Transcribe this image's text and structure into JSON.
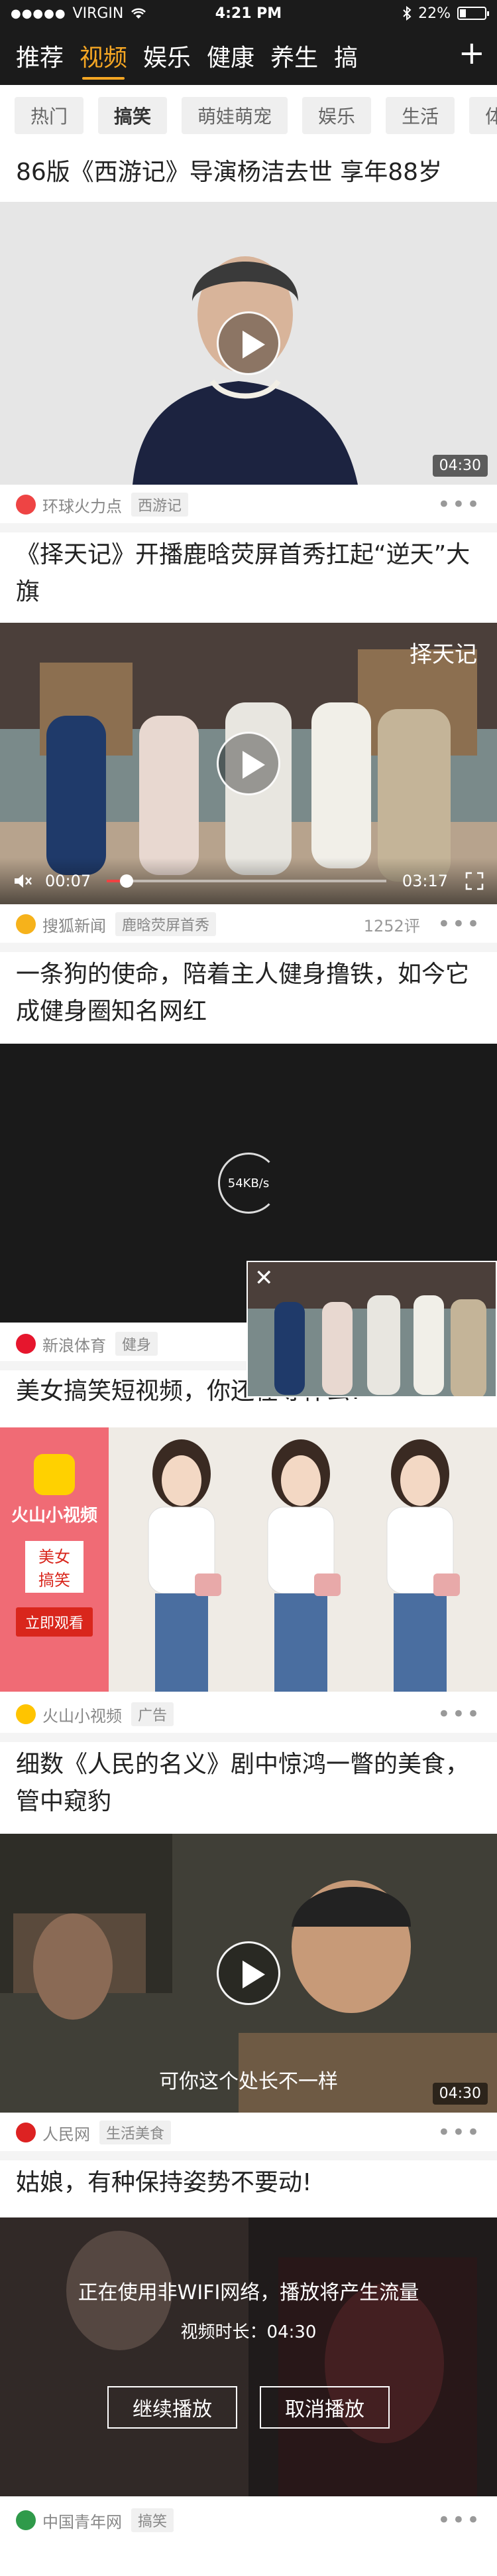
{
  "status": {
    "carrier": "VIRGIN",
    "time": "4:21 PM",
    "battery": "22%",
    "battery_level": 0.22
  },
  "tabs": [
    "推荐",
    "视频",
    "娱乐",
    "健康",
    "养生",
    "搞"
  ],
  "subcategories": [
    "热门",
    "搞笑",
    "萌娃萌宠",
    "娱乐",
    "生活",
    "体育"
  ],
  "feed": {
    "item1": {
      "title": "86版《西游记》导演杨洁去世 享年88岁",
      "duration": "04:30",
      "source": "环球火力点",
      "tag": "西游记"
    },
    "item2": {
      "title": "《择天记》开播鹿晗荧屏首秀扛起“逆天”大旗",
      "current": "00:07",
      "total": "03:17",
      "progress": 0.07,
      "source": "搜狐新闻",
      "tag": "鹿晗荧屏首秀",
      "comments": "1252评",
      "watermark": "择天记"
    },
    "item3": {
      "title": "一条狗的使命，陪着主人健身撸铁，如今它成健身圈知名网红",
      "loading": "54KB/s",
      "source": "新浪体育",
      "tag": "健身"
    },
    "item4": {
      "title": "美女搞笑短视频，你还在等什么?",
      "ad_brand": "火山小视频",
      "ad_btn": "美女\n搞笑",
      "ad_cta": "立即观看",
      "source": "火山小视频",
      "tag": "广告"
    },
    "item5": {
      "title": "细数《人民的名义》剧中惊鸿一瞥的美食，管中窥豹",
      "subtitle": "可你这个处长不一样",
      "duration": "04:30",
      "source": "人民网",
      "tag": "生活美食"
    },
    "item6": {
      "title": "姑娘，有种保持姿势不要动!",
      "warning": "正在使用非WIFI网络，播放将产生流量",
      "video_len": "视频时长：04:30",
      "continue": "继续播放",
      "cancel": "取消播放",
      "source": "中国青年网",
      "tag": "搞笑"
    }
  },
  "more_glyph": "•••",
  "plus_glyph": "+",
  "close_glyph": "✕"
}
